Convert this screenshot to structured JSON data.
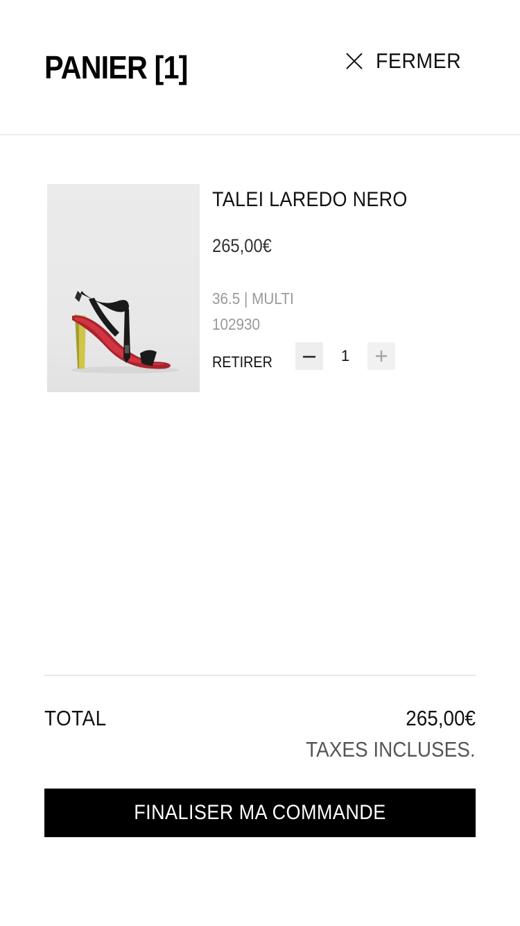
{
  "header": {
    "title": "PANIER [1]",
    "close_label": "FERMER",
    "close_icon": "close-icon"
  },
  "cart": {
    "items": [
      {
        "name": "TALEI LAREDO NERO",
        "price": "265,00€",
        "variant": "36.5 | MULTI",
        "reference": "102930",
        "remove_label": "RETIRER",
        "quantity": "1",
        "image_icon": "high-heel-sandal-image"
      }
    ]
  },
  "footer": {
    "total_label": "TOTAL",
    "total_value": "265,00€",
    "tax_note": "TAXES INCLUSES.",
    "checkout_label": "FINALISER MA COMMANDE"
  },
  "colors": {
    "button_background": "#000000",
    "qty_button_background": "#eeeeee",
    "muted_text": "#999999",
    "divider": "#e8e8e8"
  }
}
